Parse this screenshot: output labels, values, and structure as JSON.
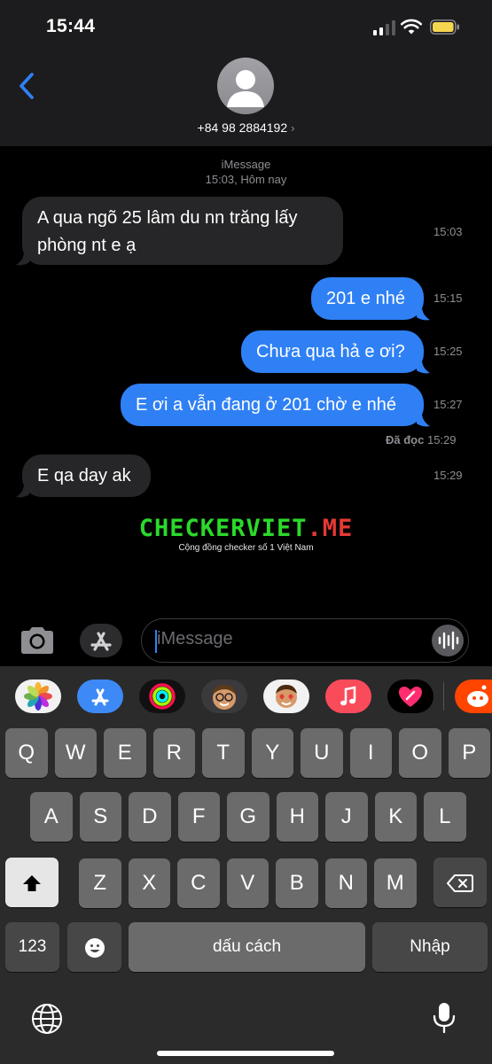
{
  "status_bar": {
    "time": "15:44"
  },
  "header": {
    "contact": "+84 98 2884192",
    "chevron": "›"
  },
  "thread": {
    "service": "iMessage",
    "date": "15:03, Hôm nay",
    "messages": [
      {
        "dir": "in",
        "text": "A qua ngõ 25 lâm du nn trăng lấy phòng nt e ạ",
        "time": "15:03"
      },
      {
        "dir": "out",
        "text": "201 e nhé",
        "time": "15:15"
      },
      {
        "dir": "out",
        "text": "Chưa qua hả e ơi?",
        "time": "15:25"
      },
      {
        "dir": "out",
        "text": "E ơi a vẫn đang ở 201 chờ e nhé",
        "time": "15:27"
      },
      {
        "dir": "in",
        "text": "E qa day ak",
        "time": "15:29"
      }
    ],
    "read_receipt": {
      "label": "Đã đọc",
      "time": "15:29"
    }
  },
  "watermark": {
    "title": "CHECKERVIET.ME",
    "subtitle": "Cộng đồng checker số 1 Việt Nam"
  },
  "composer": {
    "placeholder": "iMessage"
  },
  "app_tray": [
    "photos-icon",
    "app-store-icon",
    "activity-icon",
    "memoji-icon",
    "memoji-stickers-icon",
    "music-icon",
    "digital-touch-icon",
    "reddit-icon"
  ],
  "keyboard": {
    "row1": [
      "Q",
      "W",
      "E",
      "R",
      "T",
      "Y",
      "U",
      "I",
      "O",
      "P"
    ],
    "row2": [
      "A",
      "S",
      "D",
      "F",
      "G",
      "H",
      "J",
      "K",
      "L"
    ],
    "row3": [
      "Z",
      "X",
      "C",
      "V",
      "B",
      "N",
      "M"
    ],
    "numbers_label": "123",
    "space_label": "dấu cách",
    "return_label": "Nhập"
  },
  "colors": {
    "outgoing": "#2f80f5",
    "incoming": "#262628",
    "battery": "#f5d64f"
  }
}
